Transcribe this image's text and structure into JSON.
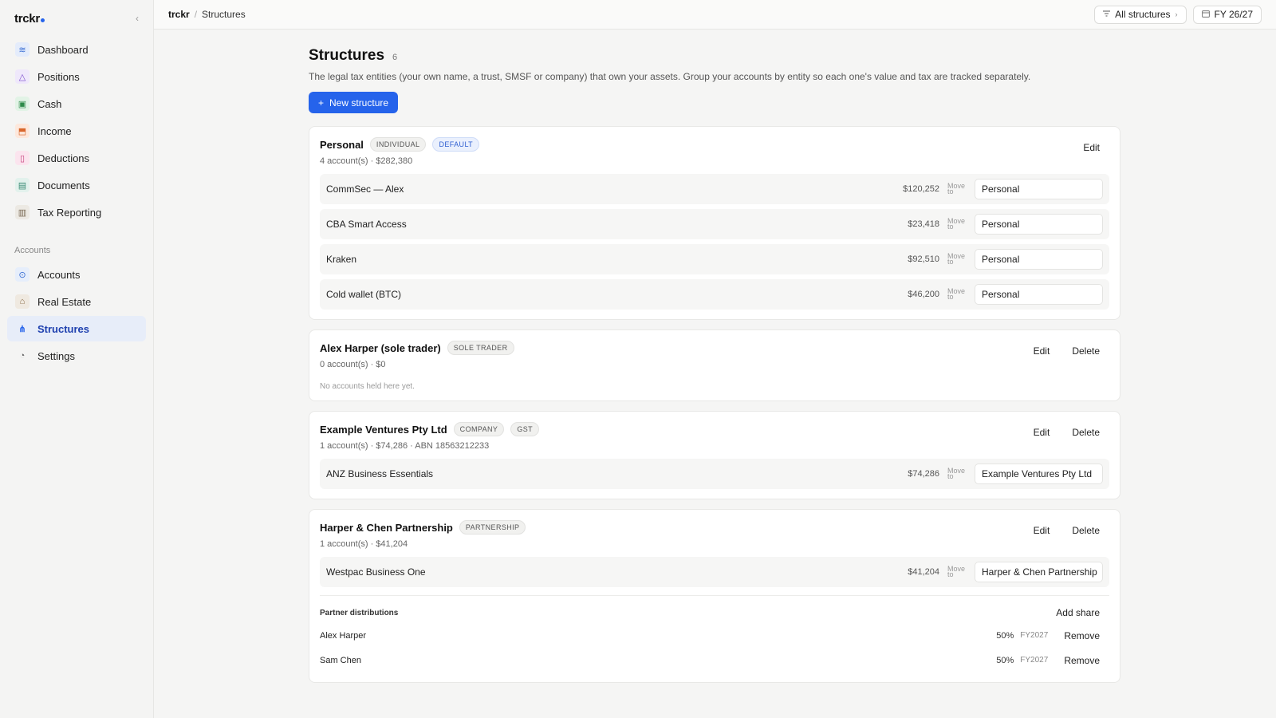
{
  "app": {
    "logo": "trckr",
    "collapse_icon": "chevron-left-icon"
  },
  "sidebar": {
    "main_items": [
      {
        "label": "Dashboard",
        "icon": "dashboard-icon"
      },
      {
        "label": "Positions",
        "icon": "positions-icon"
      },
      {
        "label": "Cash",
        "icon": "cash-icon"
      },
      {
        "label": "Income",
        "icon": "income-icon"
      },
      {
        "label": "Deductions",
        "icon": "deductions-icon"
      },
      {
        "label": "Documents",
        "icon": "documents-icon"
      },
      {
        "label": "Tax Reporting",
        "icon": "tax-reporting-icon"
      }
    ],
    "section_label": "Accounts",
    "account_items": [
      {
        "label": "Accounts",
        "icon": "accounts-icon"
      },
      {
        "label": "Real Estate",
        "icon": "real-estate-icon"
      },
      {
        "label": "Structures",
        "icon": "structures-icon",
        "active": true
      },
      {
        "label": "Settings",
        "icon": "settings-icon"
      }
    ]
  },
  "topbar": {
    "breadcrumb_root": "trckr",
    "breadcrumb_sep": "/",
    "breadcrumb_current": "Structures",
    "filter_label": "All structures",
    "fy_label": "FY 26/27"
  },
  "page": {
    "title": "Structures",
    "count": "6",
    "description": "The legal tax entities (your own name, a trust, SMSF or company) that own your assets. Group your accounts by entity so each one's value and tax are tracked separately.",
    "new_button": "New structure"
  },
  "labels": {
    "edit": "Edit",
    "delete": "Delete",
    "move_to": "Move to",
    "add_share": "Add share",
    "remove": "Remove"
  },
  "structures": [
    {
      "name": "Personal",
      "badges": [
        "INDIVIDUAL",
        "DEFAULT"
      ],
      "meta": "4 account(s) · $282,380",
      "accounts": [
        {
          "name": "CommSec — Alex",
          "value": "$120,252",
          "target": "Personal"
        },
        {
          "name": "CBA Smart Access",
          "value": "$23,418",
          "target": "Personal"
        },
        {
          "name": "Kraken",
          "value": "$92,510",
          "target": "Personal"
        },
        {
          "name": "Cold wallet (BTC)",
          "value": "$46,200",
          "target": "Personal"
        }
      ]
    },
    {
      "name": "Alex Harper (sole trader)",
      "badges": [
        "SOLE TRADER"
      ],
      "meta": "0 account(s) · $0",
      "empty": "No accounts held here yet."
    },
    {
      "name": "Example Ventures Pty Ltd",
      "badges": [
        "COMPANY",
        "GST"
      ],
      "meta": "1 account(s) · $74,286 · ABN 18563212233",
      "accounts": [
        {
          "name": "ANZ Business Essentials",
          "value": "$74,286",
          "target": "Example Ventures Pty Ltd"
        }
      ]
    },
    {
      "name": "Harper & Chen Partnership",
      "badges": [
        "PARTNERSHIP"
      ],
      "meta": "1 account(s) · $41,204",
      "accounts": [
        {
          "name": "Westpac Business One",
          "value": "$41,204",
          "target": "Harper & Chen Partnership"
        }
      ],
      "distributions_title": "Partner distributions",
      "partners": [
        {
          "name": "Alex Harper",
          "pct": "50%",
          "fy": "FY2027"
        },
        {
          "name": "Sam Chen",
          "pct": "50%",
          "fy": "FY2027"
        }
      ]
    }
  ],
  "colors": {
    "accent": "#2563eb",
    "active_bg": "#e7edf9"
  }
}
